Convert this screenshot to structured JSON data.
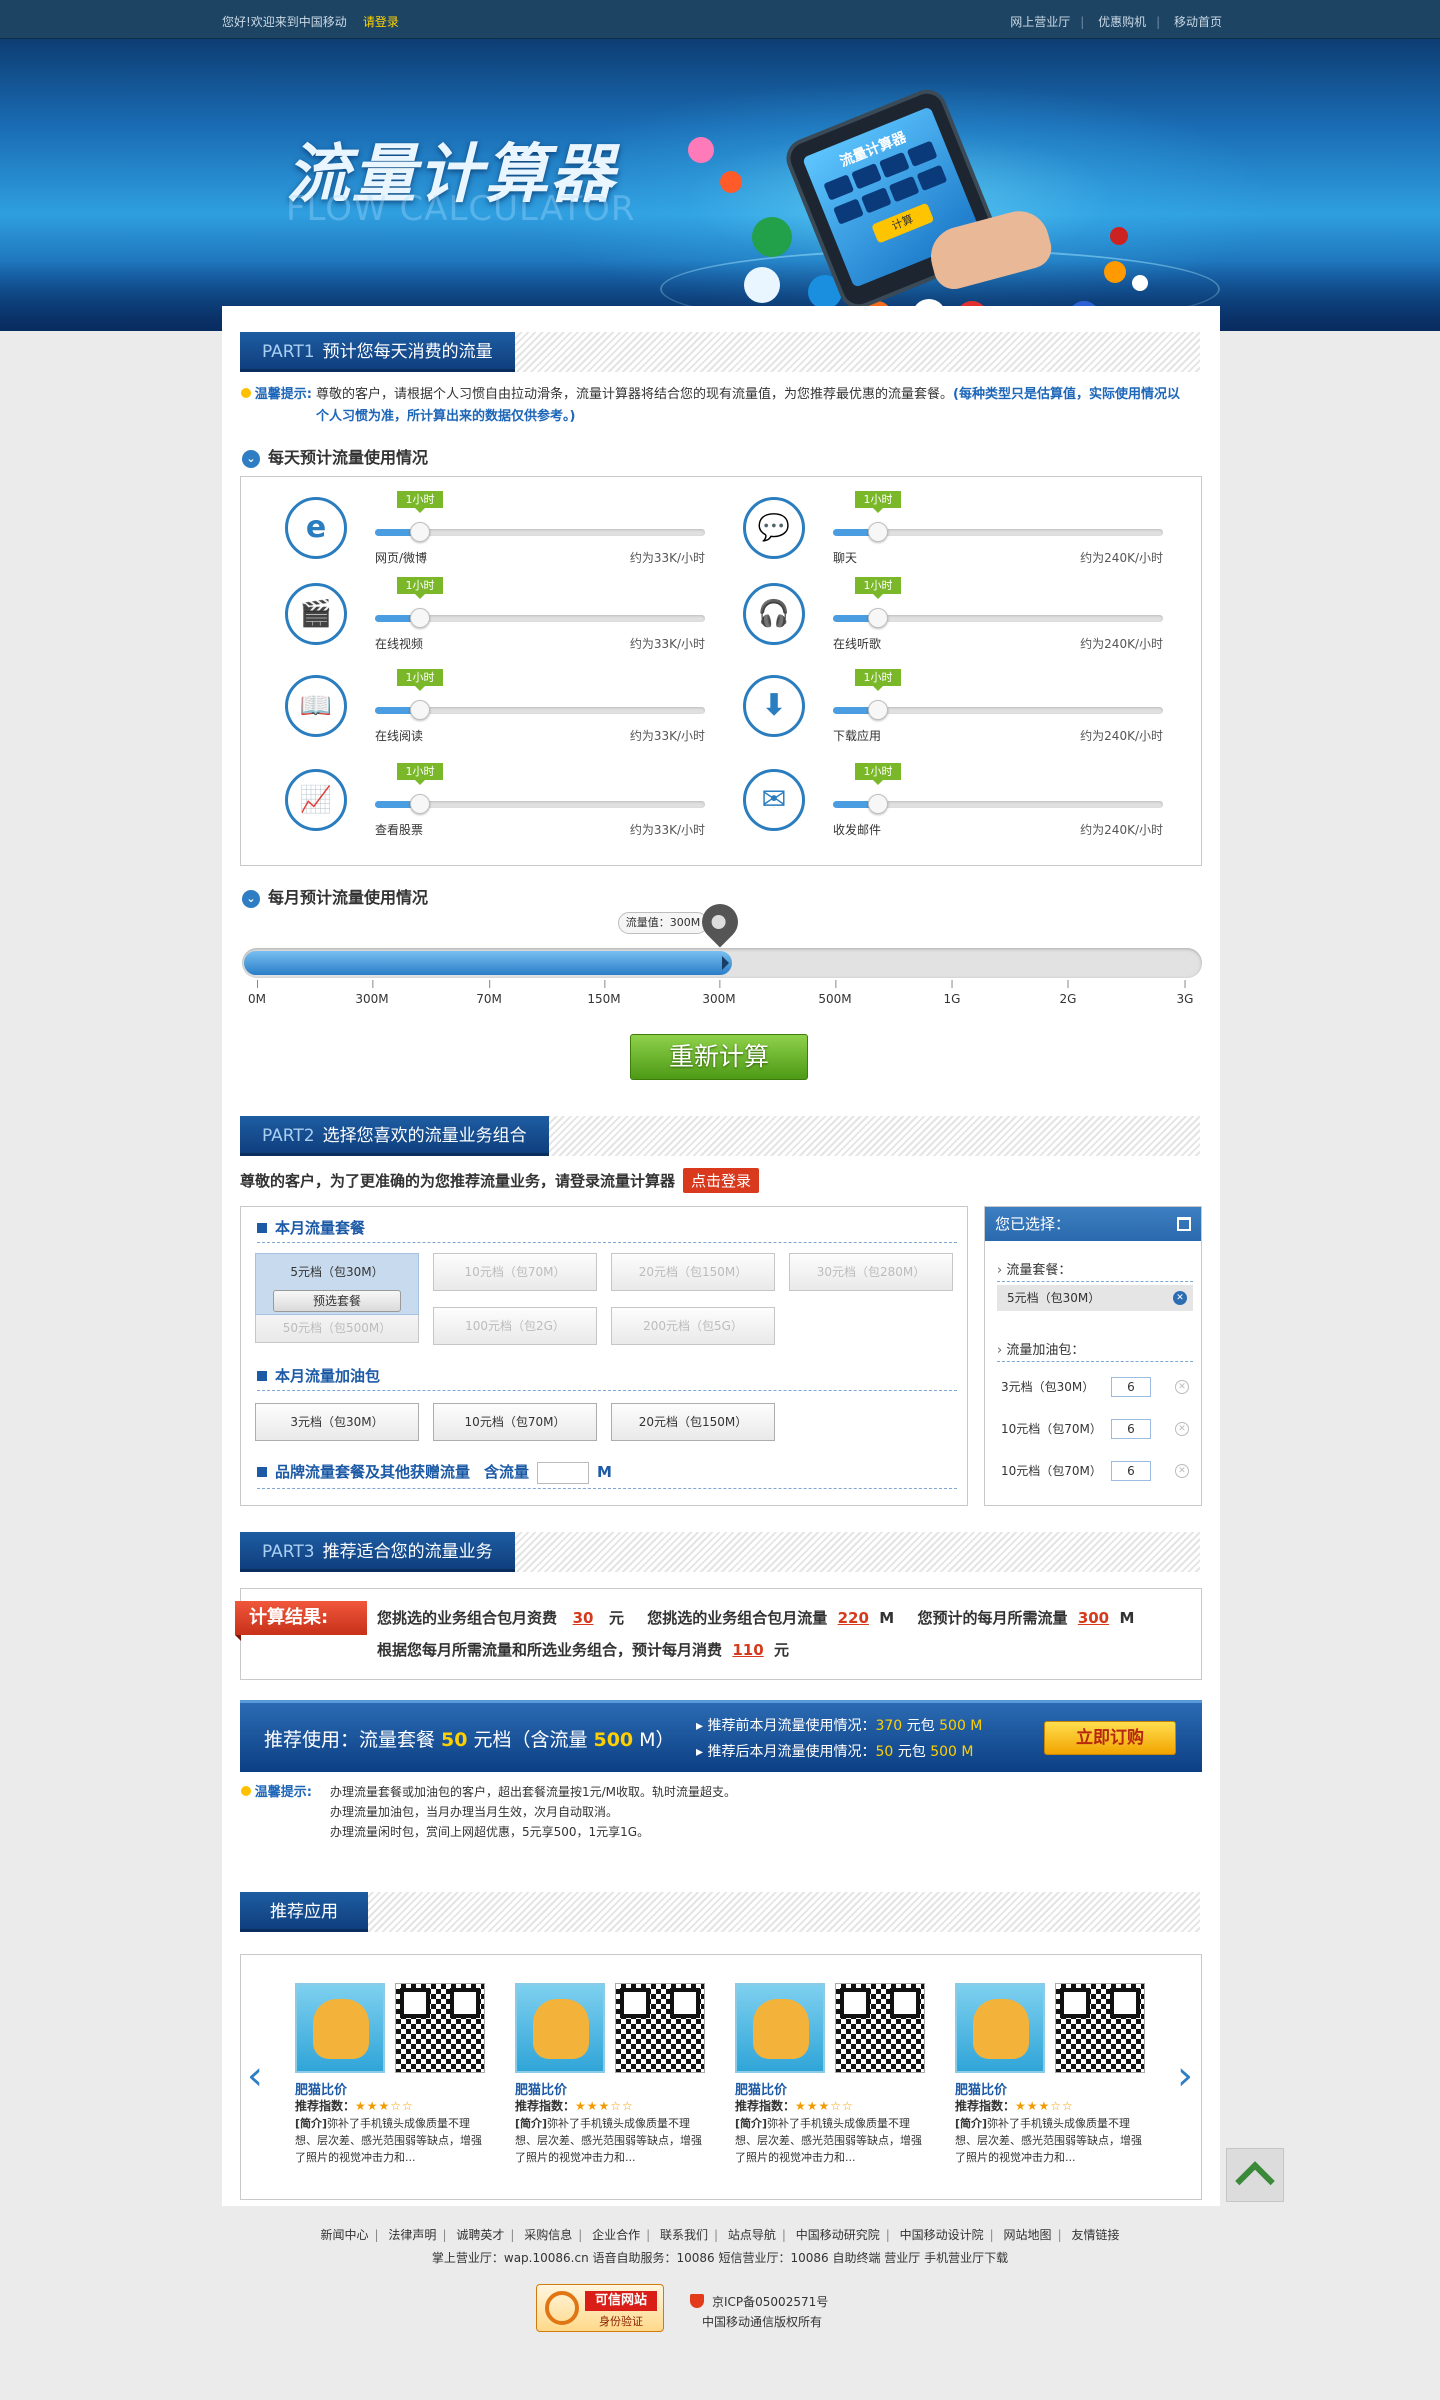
{
  "topbar": {
    "greeting": "您好!欢迎来到中国移动",
    "login": "请登录",
    "links": [
      "网上营业厅",
      "优惠购机",
      "移动首页"
    ]
  },
  "banner": {
    "title": "流量计算器",
    "subtitle": "FLOW CALCULATOR",
    "phone_title": "流量计算器",
    "phone_button": "计算"
  },
  "part1": {
    "num": "PART1",
    "title": "预计您每天消费的流量",
    "tip_label": "温馨提示:",
    "tip_text": "尊敬的客户，请根据个人习惯自由拉动滑条，流量计算器将结合您的现有流量值，为您推荐最优惠的流量套餐。",
    "tip_bold": "(每种类型只是估算值，实际使用情况以个人习惯为准，所计算出来的数据仅供参考。)",
    "daily_title": "每天预计流量使用情况",
    "items": [
      {
        "icon": "e",
        "name": "网页/微博",
        "rate": "约为33K/小时",
        "badge": "1小时",
        "level": 0.1
      },
      {
        "icon": "💬",
        "name": "聊天",
        "rate": "约为240K/小时",
        "badge": "1小时",
        "level": 0.1
      },
      {
        "icon": "🎬",
        "name": "在线视频",
        "rate": "约为33K/小时",
        "badge": "1小时",
        "level": 0.1
      },
      {
        "icon": "🎧",
        "name": "在线听歌",
        "rate": "约为240K/小时",
        "badge": "1小时",
        "level": 0.1
      },
      {
        "icon": "📖",
        "name": "在线阅读",
        "rate": "约为33K/小时",
        "badge": "1小时",
        "level": 0.1
      },
      {
        "icon": "⬇",
        "name": "下载应用",
        "rate": "约为240K/小时",
        "badge": "1小时",
        "level": 0.1
      },
      {
        "icon": "📈",
        "name": "查看股票",
        "rate": "约为33K/小时",
        "badge": "1小时",
        "level": 0.1
      },
      {
        "icon": "✉",
        "name": "收发邮件",
        "rate": "约为240K/小时",
        "badge": "1小时",
        "level": 0.1
      }
    ],
    "monthly_title": "每月预计流量使用情况",
    "monthly_label": "流量值：300M",
    "ticks": [
      "0M",
      "300M",
      "70M",
      "150M",
      "300M",
      "500M",
      "1G",
      "2G",
      "3G"
    ],
    "recalc": "重新计算"
  },
  "part2": {
    "num": "PART2",
    "title": "选择您喜欢的流量业务组合",
    "login_prompt": "尊敬的客户，为了更准确的为您推荐流量业务，请登录流量计算器",
    "login_button": "点击登录",
    "plan_title": "本月流量套餐",
    "plans": [
      "5元档（包30M）",
      "10元档（包70M）",
      "20元档（包150M）",
      "30元档（包280M）",
      "50元档（包500M）",
      "100元档（包2G）",
      "200元档（包5G）"
    ],
    "plan_preview": "预选套餐",
    "addon_title": "本月流量加油包",
    "addons": [
      "3元档（包30M）",
      "10元档（包70M）",
      "20元档（包150M）"
    ],
    "brand_title": "品牌流量套餐及其他获赠流量",
    "brand_contains": "含流量",
    "brand_unit": "M",
    "side_title": "您已选择：",
    "side_plan_label": "流量套餐：",
    "side_plan": "5元档（包30M）",
    "side_addon_label": "流量加油包：",
    "side_addons": [
      {
        "name": "3元档（包30M）",
        "qty": "6"
      },
      {
        "name": "10元档（包70M）",
        "qty": "6"
      },
      {
        "name": "10元档（包70M）",
        "qty": "6"
      }
    ]
  },
  "part3": {
    "num": "PART3",
    "title": "推荐适合您的流量业务",
    "result_tag": "计算结果:",
    "r_a": "您挑选的业务组合包月资费",
    "r_fee": "30",
    "r_yuan": "元",
    "r_b": "您挑选的业务组合包月流量",
    "r_flow": "220",
    "r_m1": "M",
    "r_c": "您预计的每月所需流量",
    "r_need": "300",
    "r_m2": "M",
    "r_d": "根据您每月所需流量和所选业务组合，预计每月消费",
    "r_total": "110",
    "r_yuan2": "元",
    "rec_a": "推荐使用：流量套餐",
    "rec_price": "50",
    "rec_b": "元档（含流量",
    "rec_flow": "500",
    "rec_c": "M）",
    "before_a": "推荐前本月流量使用情况：",
    "before_yuan": "370",
    "before_b": "元包",
    "before_flow": "500 M",
    "after_a": "推荐后本月流量使用情况：",
    "after_yuan": "50",
    "after_b": "元包",
    "after_flow": "500 M",
    "buy": "立即订购",
    "tip_label": "温馨提示:",
    "tips": [
      "办理流量套餐或加油包的客户，超出套餐流量按1元/M收取。轨时流量超支。",
      "办理流量加油包，当月办理当月生效，次月自动取消。",
      "办理流量闲时包，赏间上网超优惠，5元享500，1元享1G。"
    ]
  },
  "apps_section": {
    "title": "推荐应用",
    "items": [
      {
        "name": "肥猫比价",
        "rating_label": "推荐指数：",
        "stars": "★★★☆☆",
        "desc_label": "[简介]",
        "desc": "弥补了手机镜头成像质量不理想、层次差、感光范围弱等缺点，增强了照片的视觉冲击力和..."
      },
      {
        "name": "肥猫比价",
        "rating_label": "推荐指数：",
        "stars": "★★★☆☆",
        "desc_label": "[简介]",
        "desc": "弥补了手机镜头成像质量不理想、层次差、感光范围弱等缺点，增强了照片的视觉冲击力和..."
      },
      {
        "name": "肥猫比价",
        "rating_label": "推荐指数：",
        "stars": "★★★☆☆",
        "desc_label": "[简介]",
        "desc": "弥补了手机镜头成像质量不理想、层次差、感光范围弱等缺点，增强了照片的视觉冲击力和..."
      },
      {
        "name": "肥猫比价",
        "rating_label": "推荐指数：",
        "stars": "★★★☆☆",
        "desc_label": "[简介]",
        "desc": "弥补了手机镜头成像质量不理想、层次差、感光范围弱等缺点，增强了照片的视觉冲击力和..."
      }
    ]
  },
  "footer": {
    "links": [
      "新闻中心",
      "法律声明",
      "诚聘英才",
      "采购信息",
      "企业合作",
      "联系我们",
      "站点导航",
      "中国移动研究院",
      "中国移动设计院",
      "网站地图",
      "友情链接"
    ],
    "line2": "掌上营业厅：wap.10086.cn 语音自助服务：10086 短信营业厅：10086 自助终端 营业厅 手机营业厅下载",
    "badge_t1": "可信网站",
    "badge_t2": "身份验证",
    "icp": "京ICP备05002571号",
    "copyright": "中国移动通信版权所有"
  },
  "colors": {
    "brand_blue": "#1e5da3",
    "accent_red": "#d93a1e",
    "green": "#7ab82a",
    "yellow": "#ffd000"
  }
}
